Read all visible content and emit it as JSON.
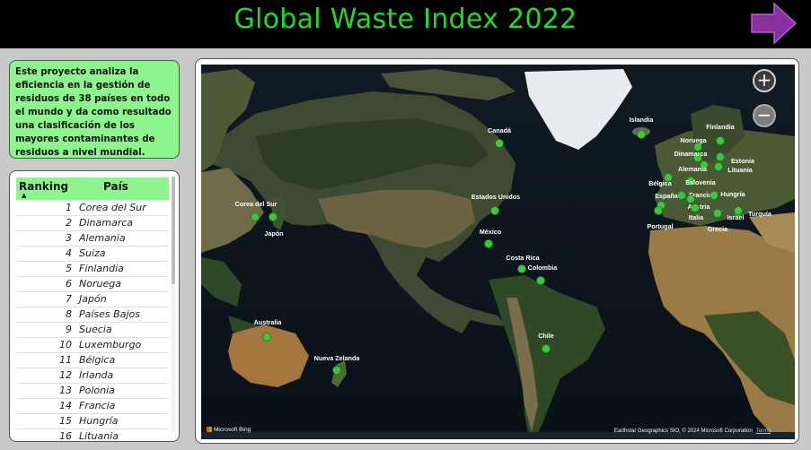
{
  "header": {
    "title": "Global Waste Index 2022",
    "next_icon": "right-arrow-icon",
    "accent_color": "#22d92a",
    "arrow_color": "#8a2f9e"
  },
  "description": {
    "text": "Este proyecto analiza la eficiencia en la gestión de residuos de 38 países en todo el mundo y da como resultado una clasificación de los mayores contaminantes de residuos a nivel mundial."
  },
  "ranking_table": {
    "headers": {
      "ranking": "Ranking",
      "pais": "País"
    },
    "sort_icon": "sort-ascending-icon",
    "rows": [
      {
        "rank": "1",
        "pais": "Corea del Sur"
      },
      {
        "rank": "2",
        "pais": "Dinamarca"
      },
      {
        "rank": "3",
        "pais": "Alemania"
      },
      {
        "rank": "4",
        "pais": "Suiza"
      },
      {
        "rank": "5",
        "pais": "Finlandia"
      },
      {
        "rank": "6",
        "pais": "Noruega"
      },
      {
        "rank": "7",
        "pais": "Japón"
      },
      {
        "rank": "8",
        "pais": "Países Bajos"
      },
      {
        "rank": "9",
        "pais": "Suecia"
      },
      {
        "rank": "10",
        "pais": "Luxemburgo"
      },
      {
        "rank": "11",
        "pais": "Bélgica"
      },
      {
        "rank": "12",
        "pais": "Irlanda"
      },
      {
        "rank": "13",
        "pais": "Polonia"
      },
      {
        "rank": "14",
        "pais": "Francia"
      },
      {
        "rank": "15",
        "pais": "Hungría"
      },
      {
        "rank": "16",
        "pais": "Lituania"
      }
    ]
  },
  "map": {
    "zoom_in": "+",
    "zoom_out": "−",
    "zoom_in_icon": "plus-icon",
    "zoom_out_icon": "minus-icon",
    "bing_logo": "Microsoft Bing",
    "attribution": "Earthstar Geographics SIO, © 2024 Microsoft Corporation",
    "terms": "Terms",
    "marker_color": "#3cc83c",
    "labels": {
      "canada": "Canadá",
      "islandia": "Islandia",
      "finlandia": "Finlandia",
      "noruega": "Noruega",
      "dinamarca": "Dinamarca",
      "estonia": "Estonia",
      "alemania": "Alemania",
      "lituania": "Lituania",
      "belgica": "Bélgica",
      "eslovenia": "Eslovenia",
      "espana": "España",
      "francia": "Francia",
      "hungria": "Hungría",
      "austria": "Austria",
      "italia": "Italia",
      "israel": "Israel",
      "turquia": "Turquía",
      "portugal": "Portugal",
      "grecia": "Grecia",
      "corea": "Corea del Sur",
      "japon": "Japón",
      "eeuu": "Estados Unidos",
      "mexico": "México",
      "costa_rica": "Costa Rica",
      "colombia": "Colombia",
      "australia": "Australia",
      "nueva_zelanda": "Nueva Zelanda",
      "chile": "Chile"
    }
  }
}
